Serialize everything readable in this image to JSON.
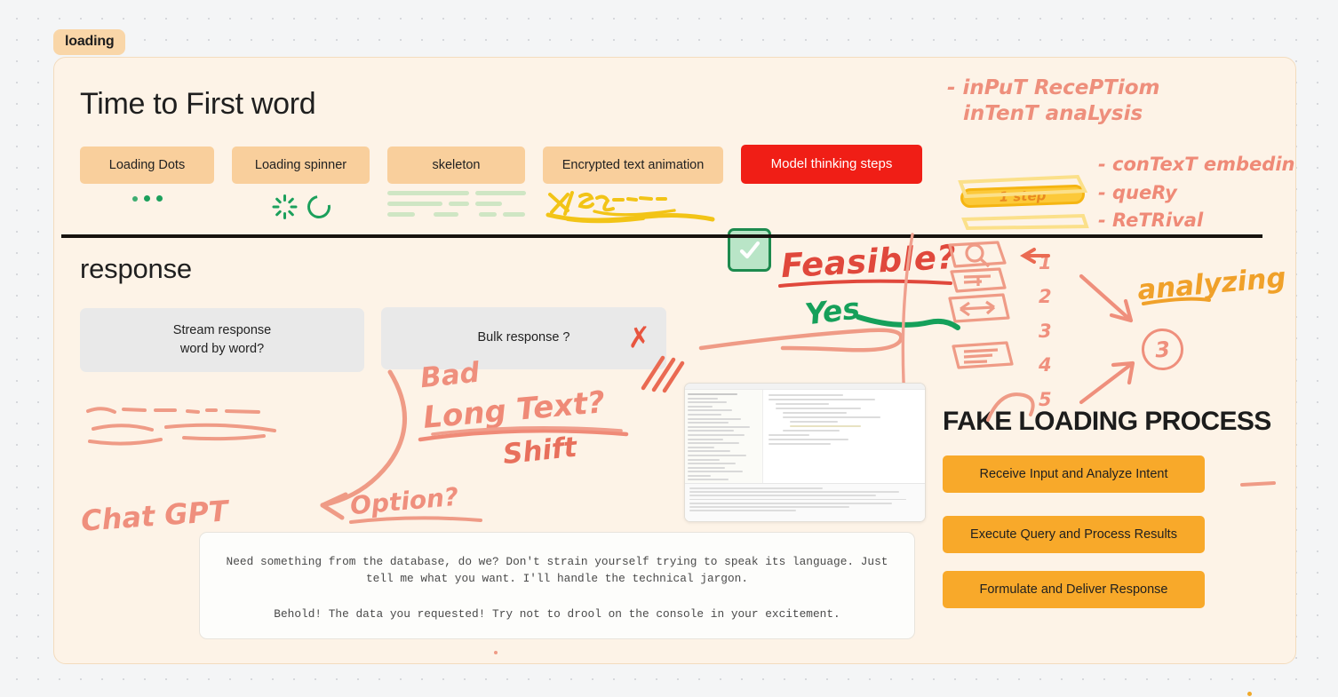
{
  "frame": {
    "tag": "loading"
  },
  "top_section": {
    "title": "Time to First word",
    "chips": [
      {
        "label": "Loading Dots",
        "name": "loading-dots"
      },
      {
        "label": "Loading spinner",
        "name": "loading-spinner"
      },
      {
        "label": "skeleton",
        "name": "skeleton"
      },
      {
        "label": "Encrypted text animation",
        "name": "encrypted-text-animation"
      },
      {
        "label": "Model thinking steps",
        "name": "model-thinking-steps",
        "style": "red"
      }
    ],
    "accent_chip_bg": "#f9cf9c",
    "accent_red": "#f01e16",
    "loader_green": "#1ca05c",
    "skeleton_green": "#cfe6c4",
    "encrypted_yellow": "#f2c417"
  },
  "annotations": {
    "feasible": "Feasible?",
    "yes": "Yes",
    "check_mark": "✓",
    "cross_mark": "✗",
    "bad": "Bad",
    "long_text": "Long Text?",
    "shift": "Shift",
    "chat_gpt": "Chat GPT",
    "option": "Option?",
    "notes_top": "- input Reception\nintent analysis",
    "notes_right": "- context embeding\n- query\n- Retrival",
    "step_badge": "1 step",
    "numbers": "1\n2\n3\n4\n5",
    "analyzing": "analyzing",
    "circled_step": "3",
    "handwriting_salmon": "#ef8f7d",
    "handwriting_red": "#e0483c",
    "handwriting_green": "#15a05a",
    "handwriting_yellow": "#f0a12a"
  },
  "response_section": {
    "title": "response",
    "cards": [
      {
        "line1": "Stream response",
        "line2": "word by word?",
        "verdict": "check"
      },
      {
        "line1": "Bulk response ?",
        "line2": "",
        "verdict": "cross"
      }
    ]
  },
  "quote_box": {
    "paragraph_1": "Need something from the database, do we? Don't strain yourself trying to speak its language. Just tell me what you want. I'll handle the technical jargon.",
    "paragraph_2": "Behold! The data you requested! Try not to drool on the console in your excitement."
  },
  "fake_loading_process": {
    "title": "FAKE LOADING PROCESS",
    "steps": [
      "Receive Input and Analyze Intent",
      "Execute Query and Process Results",
      "Formulate and Deliver Response"
    ],
    "button_bg": "#f8a92a"
  },
  "thumbnail": {
    "name": "code-editor-screenshot"
  }
}
